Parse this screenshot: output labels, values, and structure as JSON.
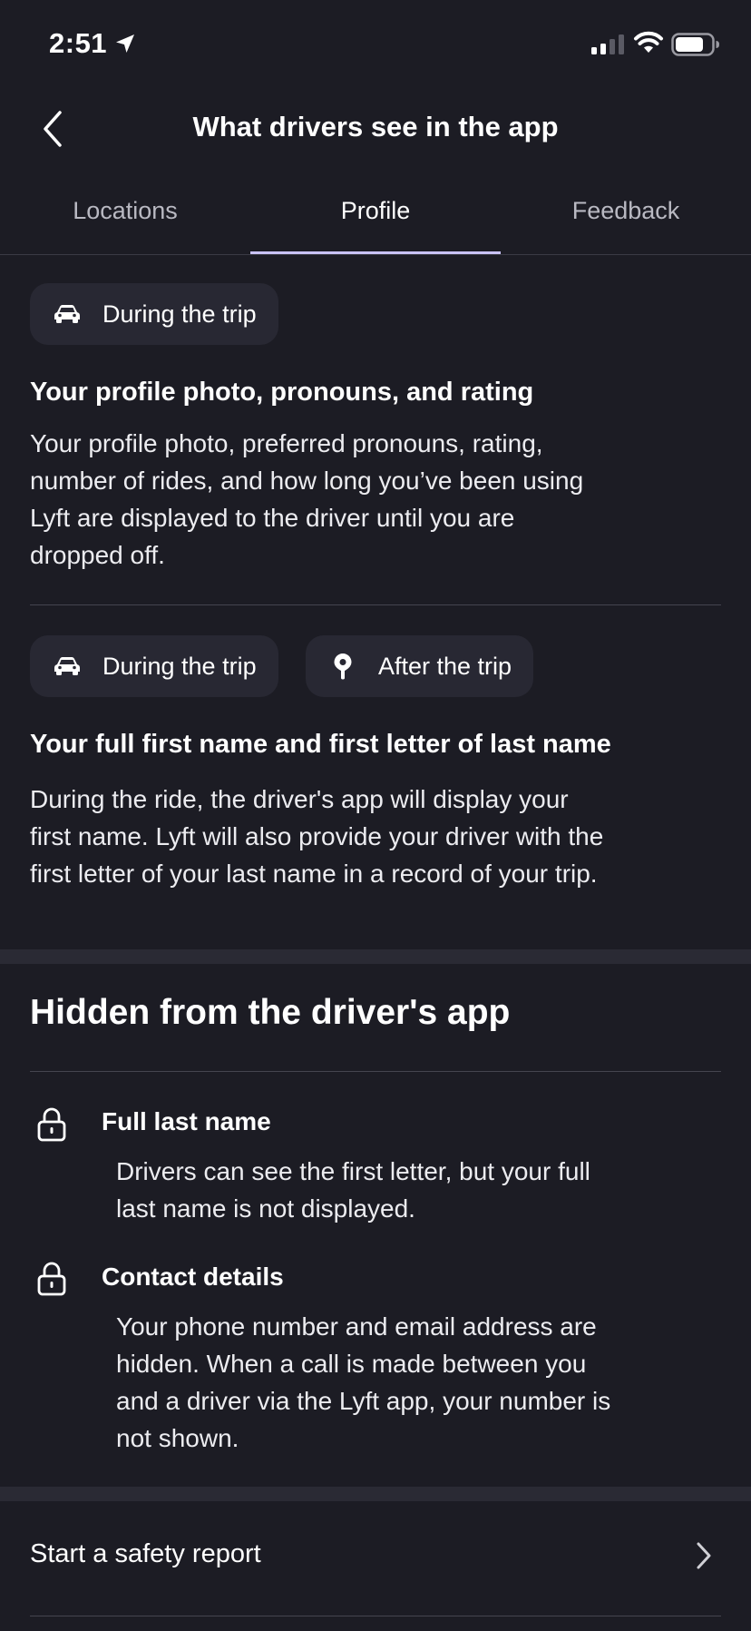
{
  "status_bar": {
    "time": "2:51",
    "icons": [
      "location-arrow-icon",
      "signal-icon",
      "wifi-icon",
      "battery-icon"
    ]
  },
  "header": {
    "title": "What drivers see in the app",
    "back_icon": "chevron-left-icon"
  },
  "tabs": [
    {
      "label": "Locations",
      "active": false
    },
    {
      "label": "Profile",
      "active": true
    },
    {
      "label": "Feedback",
      "active": false
    }
  ],
  "sections": [
    {
      "chips": [
        {
          "label": "During the trip",
          "icon": "car-icon"
        }
      ],
      "title": "Your profile photo, pronouns, and rating",
      "lines": [
        "Your profile photo, preferred pronouns, rating,",
        "number of rides, and how long you’ve been using",
        "Lyft are displayed to the driver until you are",
        "dropped off."
      ]
    },
    {
      "chips": [
        {
          "label": "During the trip",
          "icon": "car-icon"
        },
        {
          "label": "After the trip",
          "icon": "map-pin-icon"
        }
      ],
      "title": "Your full first name and first letter of last name",
      "lines": [
        "During the ride, the driver's app will display your",
        "first name. Lyft will also provide your driver with the",
        "first letter of your last name in a record of your trip."
      ]
    }
  ],
  "hidden": {
    "title": "Hidden from the driver's app",
    "items": [
      {
        "icon": "lock-icon",
        "title": "Full last name",
        "lines": [
          "Drivers can see the first letter, but your full",
          "last name is not displayed."
        ]
      },
      {
        "icon": "lock-icon",
        "title": "Contact details",
        "lines": [
          "Your phone number and email address are",
          "hidden. When a call is made between you",
          "and a driver via the Lyft app, your number is",
          "not shown."
        ]
      }
    ]
  },
  "report": {
    "label": "Start a safety report",
    "icon": "chevron-right-icon"
  },
  "colors": {
    "background": "#1c1c24",
    "chip_background": "#282833",
    "tab_underline": "#c9c2f6",
    "divider": "#45454f"
  }
}
